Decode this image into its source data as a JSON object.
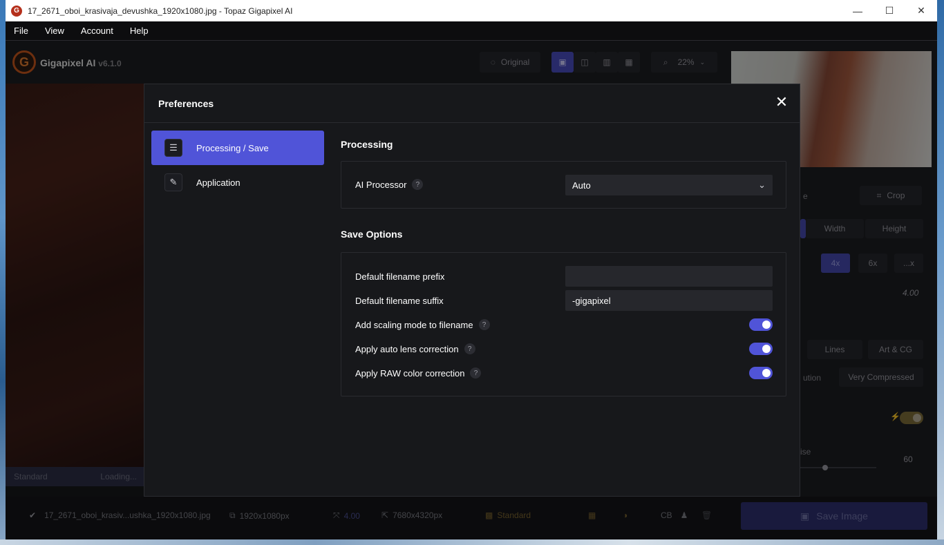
{
  "window": {
    "title": "17_2671_oboi_krasivaja_devushka_1920x1080.jpg - Topaz Gigapixel AI",
    "controls": {
      "minimize": "—",
      "maximize": "☐",
      "close": "✕"
    }
  },
  "menubar": {
    "items": [
      {
        "label": "File"
      },
      {
        "label": "View"
      },
      {
        "label": "Account"
      },
      {
        "label": "Help"
      }
    ]
  },
  "brand": {
    "name": "Gigapixel AI",
    "version": "v6.1.0",
    "logo_letter": "G"
  },
  "toolbar": {
    "original_label": "Original",
    "zoom": "22%"
  },
  "photo_status": {
    "left": "Standard",
    "right": "Loading..."
  },
  "right_panel": {
    "crop_label": "Crop",
    "scale_tabs": [
      "Width",
      "Height"
    ],
    "scale_buttons": [
      "4x",
      "6x",
      "...x"
    ],
    "scale_value": "4.00",
    "model_buttons": [
      "Lines",
      "Art & CG"
    ],
    "partial_label_1": "e",
    "partial_label_2": "ution",
    "compression_label": "Very Compressed",
    "noise_label": "ise",
    "noise_value": "60"
  },
  "statusbar": {
    "filename": "17_2671_oboi_krasiv...ushka_1920x1080.jpg",
    "input_size": "1920x1080px",
    "scale": "4.00",
    "output_size": "7680x4320px",
    "model": "Standard",
    "cb_label": "CB",
    "save_label": "Save Image"
  },
  "preferences": {
    "title": "Preferences",
    "sidebar": [
      {
        "label": "Processing / Save",
        "active": true
      },
      {
        "label": "Application",
        "active": false
      }
    ],
    "processing": {
      "section_title": "Processing",
      "ai_processor_label": "AI Processor",
      "ai_processor_value": "Auto"
    },
    "save_options": {
      "section_title": "Save Options",
      "prefix_label": "Default filename prefix",
      "prefix_value": "",
      "suffix_label": "Default filename suffix",
      "suffix_value": "-gigapixel",
      "scaling_mode_label": "Add scaling mode to filename",
      "scaling_mode_on": true,
      "lens_label": "Apply auto lens correction",
      "lens_on": true,
      "raw_label": "Apply RAW color correction",
      "raw_on": true
    }
  },
  "colors": {
    "accent": "#5054d8",
    "background": "#17181b",
    "brand_orange": "#c6561d"
  }
}
